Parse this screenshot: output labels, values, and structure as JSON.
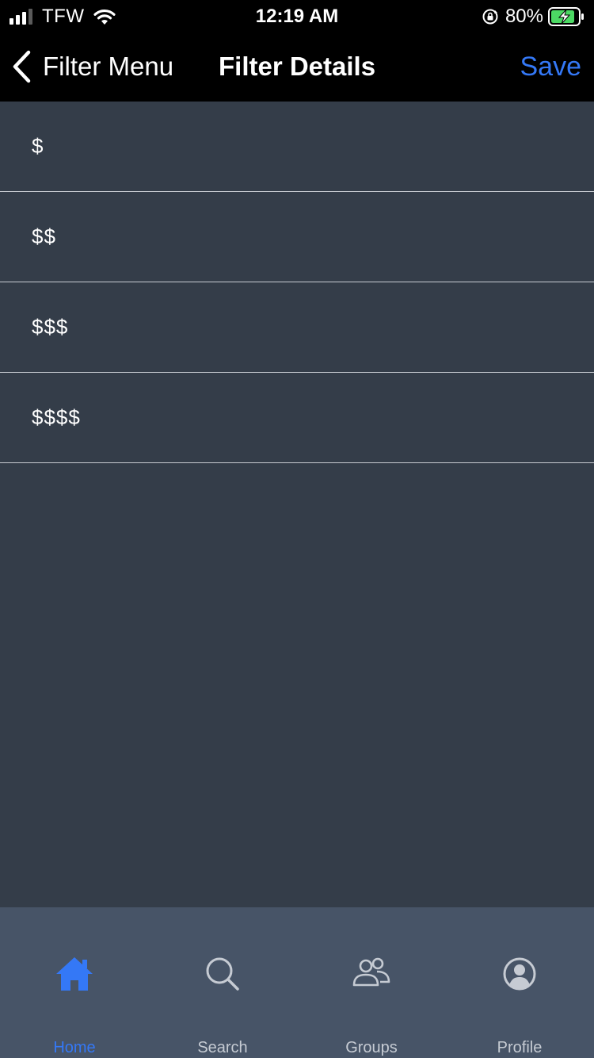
{
  "status_bar": {
    "carrier": "TFW",
    "time": "12:19 AM",
    "battery_percent": "80%"
  },
  "nav": {
    "back_label": "Filter Menu",
    "title": "Filter Details",
    "save_label": "Save"
  },
  "options": [
    {
      "label": "$"
    },
    {
      "label": "$$"
    },
    {
      "label": "$$$"
    },
    {
      "label": "$$$$"
    }
  ],
  "tabs": [
    {
      "label": "Home",
      "icon": "home-icon",
      "active": true
    },
    {
      "label": "Search",
      "icon": "search-icon",
      "active": false
    },
    {
      "label": "Groups",
      "icon": "groups-icon",
      "active": false
    },
    {
      "label": "Profile",
      "icon": "profile-icon",
      "active": false
    }
  ],
  "colors": {
    "accent": "#3478f6",
    "background": "#343d49",
    "tab_bar": "#475467",
    "battery_charge": "#4cd964"
  }
}
